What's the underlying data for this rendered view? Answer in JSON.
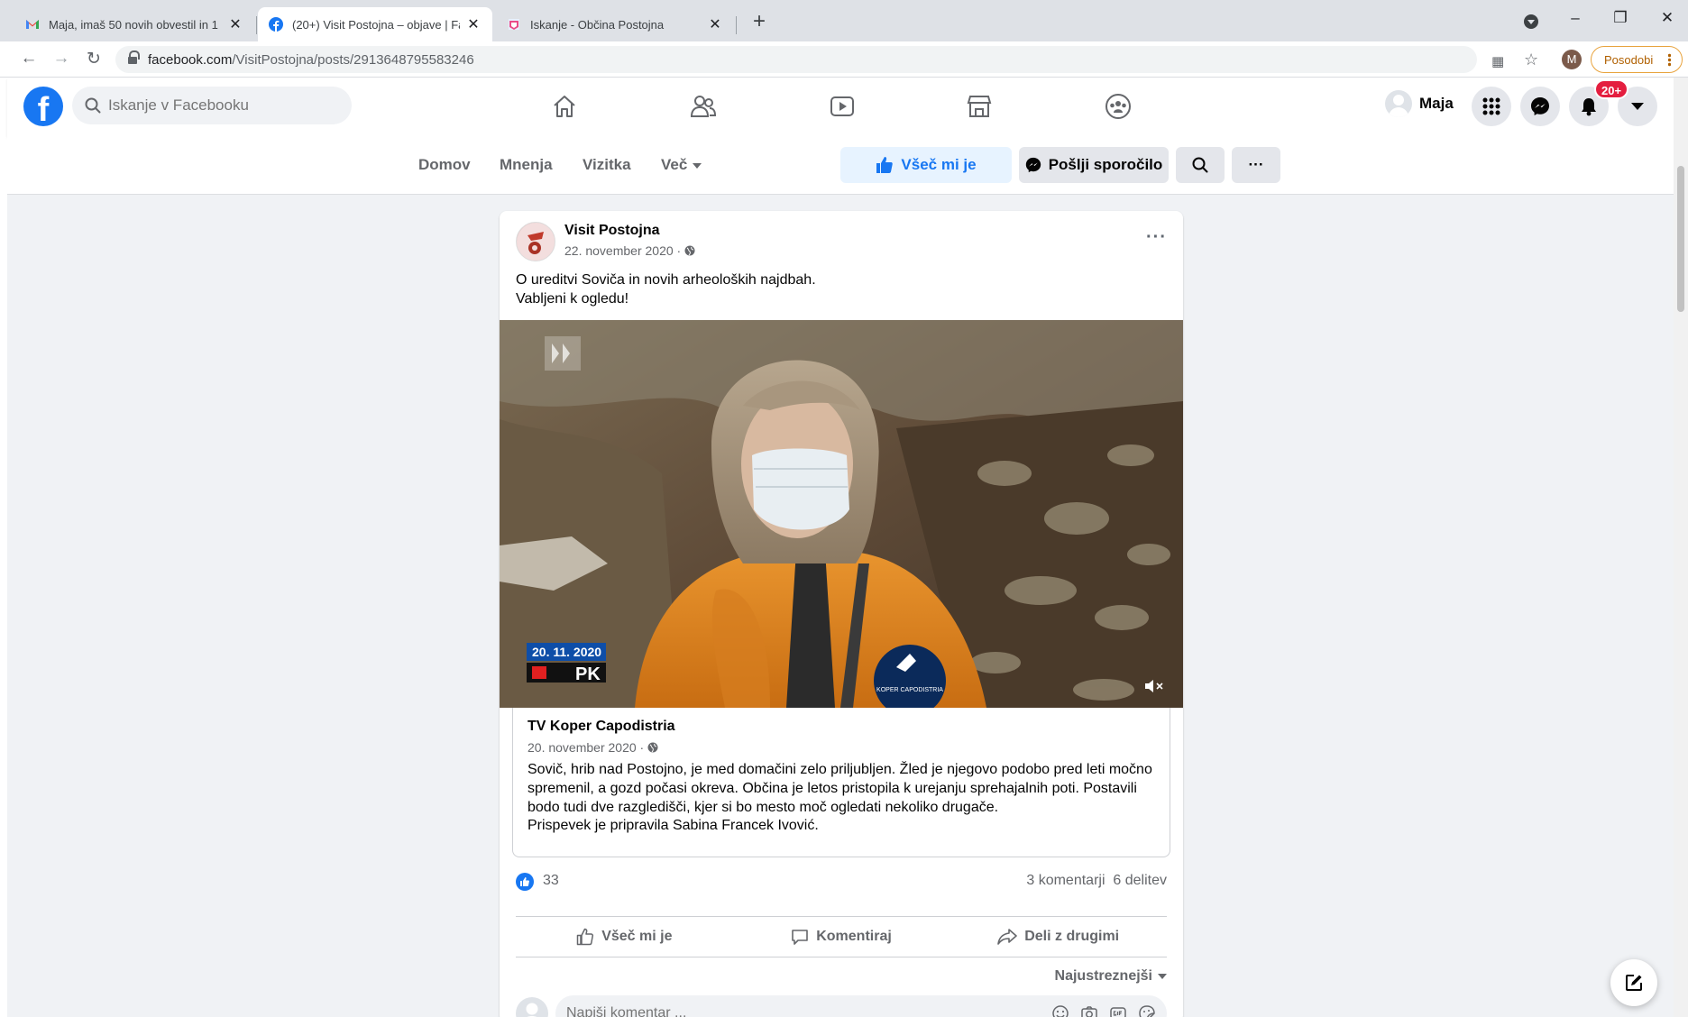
{
  "browser": {
    "tabs": [
      {
        "title": "Maja, imaš 50 novih obvestil in 1",
        "icon": "gmail-icon",
        "close": "✕"
      },
      {
        "title": "(20+) Visit Postojna – objave | Fa",
        "icon": "facebook-icon",
        "close": "✕"
      },
      {
        "title": "Iskanje - Občina Postojna",
        "icon": "obcina-icon",
        "close": "✕"
      }
    ],
    "new_tab": "+",
    "url_host": "facebook.com",
    "url_path": "/VisitPostojna/posts/2913648795583246",
    "profile_initial": "M",
    "update_label": "Posodobi"
  },
  "fb": {
    "search_placeholder": "Iskanje v Facebooku",
    "user_name": "Maja",
    "notif_badge": "20+"
  },
  "subnav": {
    "items": [
      "Domov",
      "Mnenja",
      "Vizitka",
      "Več"
    ],
    "like_label": "Všeč mi je",
    "message_label": "Pošlji sporočilo",
    "more": "···"
  },
  "post": {
    "author": "Visit Postojna",
    "date": "22. november 2020 · ",
    "more": "···",
    "text_line1": "O ureditvi Soviča in novih arheoloških najdbah.",
    "text_line2": "Vabljeni k ogledu!",
    "video": {
      "date_overlay": "20. 11. 2020",
      "tag_overlay": "PK",
      "mic_label": "KOPER CAPODISTRIA"
    },
    "shared": {
      "name": "TV Koper Capodistria",
      "date": "20. november 2020 · ",
      "body": "Sovič, hrib nad Postojno, je med domačini zelo priljubljen. Žled je njegovo podobo pred leti močno spremenil, a gozd počasi okreva. Občina je letos pristopila k urejanju sprehajalnih poti. Postavili bodo tudi dve razgledišči, kjer si bo mesto moč ogledati nekoliko drugače.",
      "credit": "Prispevek je pripravila Sabina Francek Ivović."
    },
    "likes_count": "33",
    "comments_count": "3 komentarji",
    "shares_count": "6 delitev",
    "actions": {
      "like": "Všeč mi je",
      "comment": "Komentiraj",
      "share": "Deli z drugimi"
    },
    "sort_label": "Najustreznejši",
    "comment_placeholder": "Napiši komentar ..."
  }
}
